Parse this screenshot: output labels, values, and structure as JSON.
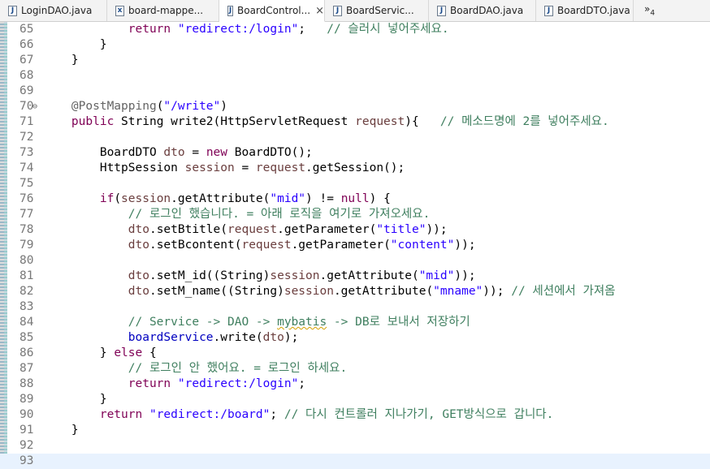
{
  "tabs": [
    {
      "label": "LoginDAO.java",
      "icon": "java-file-icon",
      "glyph": "J"
    },
    {
      "label": "board-mappe...",
      "icon": "xml-file-icon",
      "glyph": "x"
    },
    {
      "label": "BoardControl...",
      "icon": "java-file-icon",
      "glyph": "J",
      "active": true
    },
    {
      "label": "BoardServic...",
      "icon": "java-file-icon",
      "glyph": "J"
    },
    {
      "label": "BoardDAO.java",
      "icon": "java-file-icon",
      "glyph": "J"
    },
    {
      "label": "BoardDTO.java",
      "icon": "java-file-icon",
      "glyph": "J"
    }
  ],
  "overflow": {
    "symbol": "»",
    "count": "4"
  },
  "lines": [
    {
      "n": "65",
      "tokens": [
        [
          "",
          "            "
        ],
        [
          "kw",
          "return"
        ],
        [
          "",
          " "
        ],
        [
          "str",
          "\"redirect:/login\""
        ],
        [
          "",
          ";   "
        ],
        [
          "cm",
          "// 슬러시 넣어주세요."
        ]
      ]
    },
    {
      "n": "66",
      "tokens": [
        [
          "",
          "        }"
        ]
      ]
    },
    {
      "n": "67",
      "tokens": [
        [
          "",
          "    }"
        ]
      ]
    },
    {
      "n": "68",
      "tokens": []
    },
    {
      "n": "69",
      "tokens": []
    },
    {
      "n": "70",
      "fold": true,
      "tokens": [
        [
          "",
          "    "
        ],
        [
          "ann",
          "@PostMapping"
        ],
        [
          "",
          "("
        ],
        [
          "str",
          "\"/write\""
        ],
        [
          "",
          ")"
        ]
      ]
    },
    {
      "n": "71",
      "tokens": [
        [
          "",
          "    "
        ],
        [
          "kw",
          "public"
        ],
        [
          "",
          " String write2(HttpServletRequest "
        ],
        [
          "var",
          "request"
        ],
        [
          "",
          "){   "
        ],
        [
          "cm",
          "// 메소드명에 2를 넣어주세요."
        ]
      ]
    },
    {
      "n": "72",
      "tokens": []
    },
    {
      "n": "73",
      "tokens": [
        [
          "",
          "        BoardDTO "
        ],
        [
          "var",
          "dto"
        ],
        [
          "",
          " = "
        ],
        [
          "kw",
          "new"
        ],
        [
          "",
          " BoardDTO();"
        ]
      ]
    },
    {
      "n": "74",
      "tokens": [
        [
          "",
          "        HttpSession "
        ],
        [
          "var",
          "session"
        ],
        [
          "",
          " = "
        ],
        [
          "var",
          "request"
        ],
        [
          "",
          ".getSession();"
        ]
      ]
    },
    {
      "n": "75",
      "tokens": []
    },
    {
      "n": "76",
      "tokens": [
        [
          "",
          "        "
        ],
        [
          "kw",
          "if"
        ],
        [
          "",
          "("
        ],
        [
          "var",
          "session"
        ],
        [
          "",
          ".getAttribute("
        ],
        [
          "str",
          "\"mid\""
        ],
        [
          "",
          ") != "
        ],
        [
          "kw",
          "null"
        ],
        [
          "",
          ") {"
        ]
      ]
    },
    {
      "n": "77",
      "tokens": [
        [
          "",
          "            "
        ],
        [
          "cm",
          "// 로그인 했습니다. = 아래 로직을 여기로 가져오세요."
        ]
      ]
    },
    {
      "n": "78",
      "tokens": [
        [
          "",
          "            "
        ],
        [
          "var",
          "dto"
        ],
        [
          "",
          ".setBtitle("
        ],
        [
          "var",
          "request"
        ],
        [
          "",
          ".getParameter("
        ],
        [
          "str",
          "\"title\""
        ],
        [
          "",
          "));"
        ]
      ]
    },
    {
      "n": "79",
      "tokens": [
        [
          "",
          "            "
        ],
        [
          "var",
          "dto"
        ],
        [
          "",
          ".setBcontent("
        ],
        [
          "var",
          "request"
        ],
        [
          "",
          ".getParameter("
        ],
        [
          "str",
          "\"content\""
        ],
        [
          "",
          "));"
        ]
      ]
    },
    {
      "n": "80",
      "tokens": []
    },
    {
      "n": "81",
      "tokens": [
        [
          "",
          "            "
        ],
        [
          "var",
          "dto"
        ],
        [
          "",
          ".setM_id((String)"
        ],
        [
          "var",
          "session"
        ],
        [
          "",
          ".getAttribute("
        ],
        [
          "str",
          "\"mid\""
        ],
        [
          "",
          "));"
        ]
      ]
    },
    {
      "n": "82",
      "tokens": [
        [
          "",
          "            "
        ],
        [
          "var",
          "dto"
        ],
        [
          "",
          ".setM_name((String)"
        ],
        [
          "var",
          "session"
        ],
        [
          "",
          ".getAttribute("
        ],
        [
          "str",
          "\"mname\""
        ],
        [
          "",
          "));"
        ],
        [
          "",
          " "
        ],
        [
          "cm",
          "// 세션에서 가져옴"
        ]
      ]
    },
    {
      "n": "83",
      "tokens": []
    },
    {
      "n": "84",
      "tokens": [
        [
          "",
          "            "
        ],
        [
          "cm",
          "// Service -> DAO -> "
        ],
        [
          "cm squig",
          "mybatis"
        ],
        [
          "cm",
          " -> DB로 보내서 저장하기"
        ]
      ]
    },
    {
      "n": "85",
      "tokens": [
        [
          "",
          "            "
        ],
        [
          "fld",
          "boardService"
        ],
        [
          "",
          ".write("
        ],
        [
          "var",
          "dto"
        ],
        [
          "",
          ");"
        ]
      ]
    },
    {
      "n": "86",
      "tokens": [
        [
          "",
          "        } "
        ],
        [
          "kw",
          "else"
        ],
        [
          "",
          " {"
        ]
      ]
    },
    {
      "n": "87",
      "tokens": [
        [
          "",
          "            "
        ],
        [
          "cm",
          "// 로그인 안 했어요. = 로그인 하세요."
        ]
      ]
    },
    {
      "n": "88",
      "tokens": [
        [
          "",
          "            "
        ],
        [
          "kw",
          "return"
        ],
        [
          "",
          " "
        ],
        [
          "str",
          "\"redirect:/login\""
        ],
        [
          "",
          ";"
        ]
      ]
    },
    {
      "n": "89",
      "tokens": [
        [
          "",
          "        }"
        ]
      ]
    },
    {
      "n": "90",
      "tokens": [
        [
          "",
          "        "
        ],
        [
          "kw",
          "return"
        ],
        [
          "",
          " "
        ],
        [
          "str",
          "\"redirect:/board\""
        ],
        [
          "",
          "; "
        ],
        [
          "cm",
          "// 다시 컨트롤러 지나가기, GET방식으로 갑니다."
        ]
      ]
    },
    {
      "n": "91",
      "tokens": [
        [
          "",
          "    }"
        ]
      ]
    },
    {
      "n": "92",
      "tokens": []
    },
    {
      "n": "93",
      "current": true,
      "tokens": []
    }
  ]
}
